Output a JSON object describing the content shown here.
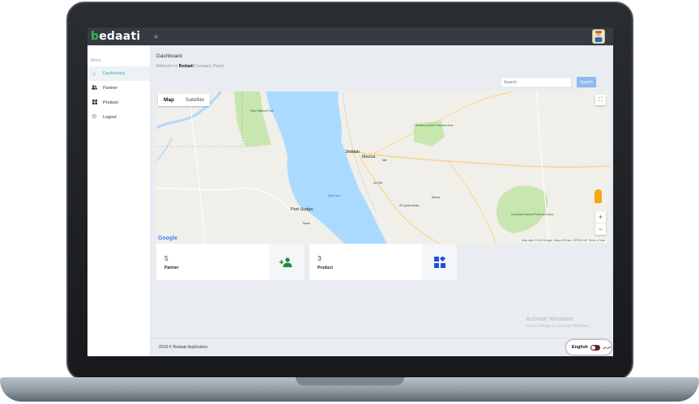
{
  "brand": {
    "name_accent": "b",
    "name_rest": "edaati"
  },
  "topbar": {
    "menu_toggle": "≡"
  },
  "sidebar": {
    "menu_label": "Menu",
    "items": [
      {
        "label": "Dashboard",
        "icon": "home-icon",
        "active": true
      },
      {
        "label": "Partner",
        "icon": "users-icon",
        "active": false
      },
      {
        "label": "Product",
        "icon": "grid-icon",
        "active": false
      },
      {
        "label": "Logout",
        "icon": "power-icon",
        "active": false
      }
    ]
  },
  "header": {
    "title": "Dashboard",
    "welcome_prefix": "Welcome to ",
    "welcome_brand": "Bedaati",
    "welcome_suffix": " Company Panel"
  },
  "search": {
    "placeholder": "Search",
    "button_label": "Search"
  },
  "map": {
    "tabs": [
      {
        "label": "Map",
        "active": true
      },
      {
        "label": "Satellite",
        "active": false
      }
    ],
    "fullscreen_icon": "⛶",
    "zoom_in": "+",
    "zoom_out": "−",
    "google_logo": "Google",
    "attribution": "Map data ©2018 Google, Mapa GISrael, ORION-ME   Terms of Use",
    "labels": {
      "jeddah": "Jeddah",
      "mecca": "Mecca",
      "port_sudan": "Port Sudan",
      "taif": "Taif",
      "red_sea": "Red Sea",
      "elba": "Elba National Park",
      "shada": "Shada al Asfal Protected Area",
      "uruq": "Uruq Bani Ma'arid Protected Area",
      "bisha": "Bisha",
      "al_lith": "Al Lith",
      "al_qunfudhah": "Al Qunfudhah",
      "tokar": "Tokar"
    },
    "colors": {
      "water": "#aadaff",
      "land": "#f1efe9",
      "park": "#c8e6b0"
    }
  },
  "cards": [
    {
      "value": "5",
      "label": "Partner",
      "icon": "add-user-icon",
      "icon_color": "#1e8a3e"
    },
    {
      "value": "3",
      "label": "Product",
      "icon": "widgets-icon",
      "icon_color": "#1e4fd6"
    }
  ],
  "watermark": {
    "title": "Activate Windows",
    "subtitle": "Go to Settings to activate Windows."
  },
  "footer": {
    "copyright": "2018 © Bedaati Application."
  },
  "language": {
    "current": "English",
    "alternate": "عربي"
  }
}
